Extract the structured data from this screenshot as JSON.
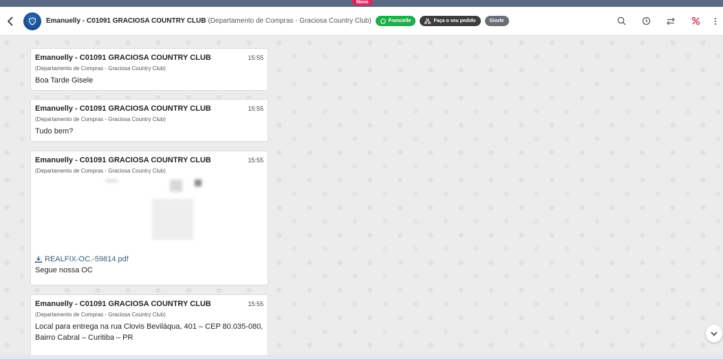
{
  "app": {
    "novo_badge": "Novo"
  },
  "header": {
    "contact_name": "Emanuelly - C01091 GRACIOSA COUNTRY CLUB",
    "contact_dept": "(Departamento de Compras - Graciosa Country Club)",
    "pill_whatsapp": "Francielle",
    "pill_order": "Faça o seu pedido",
    "pill_agent": "Gisele",
    "colors": {
      "green": "#1fae4b",
      "dark": "#3d3d3d",
      "grey": "#6b6f75",
      "accent_red": "#e0245e"
    },
    "icons": [
      "search-icon",
      "history-icon",
      "transfer-icon",
      "discount-icon",
      "more-vertical-icon"
    ]
  },
  "messages": [
    {
      "sender": "Emanuelly - C01091 GRACIOSA COUNTRY CLUB",
      "time": "15:55",
      "dept": "(Departamento de Compras - Graciosa Country Club)",
      "text": "Boa Tarde Gisele"
    },
    {
      "sender": "Emanuelly - C01091 GRACIOSA COUNTRY CLUB",
      "time": "15:55",
      "dept": "(Departamento de Compras - Graciosa Country Club)",
      "text": "Tudo bem?"
    },
    {
      "sender": "Emanuelly - C01091 GRACIOSA COUNTRY CLUB",
      "time": "15:55",
      "dept": "(Departamento de Compras - Graciosa Country Club)",
      "attachment": "REALFIX-OC.-59814.pdf",
      "text": "Segue nossa OC"
    },
    {
      "sender": "Emanuelly - C01091 GRACIOSA COUNTRY CLUB",
      "time": "15:55",
      "dept": "(Departamento de Compras - Graciosa Country Club)",
      "text": "Local para entrega na rua Clovis Beviláqua, 401 – CEP 80.035-080, Bairro Cabral – Curitiba – PR"
    }
  ]
}
